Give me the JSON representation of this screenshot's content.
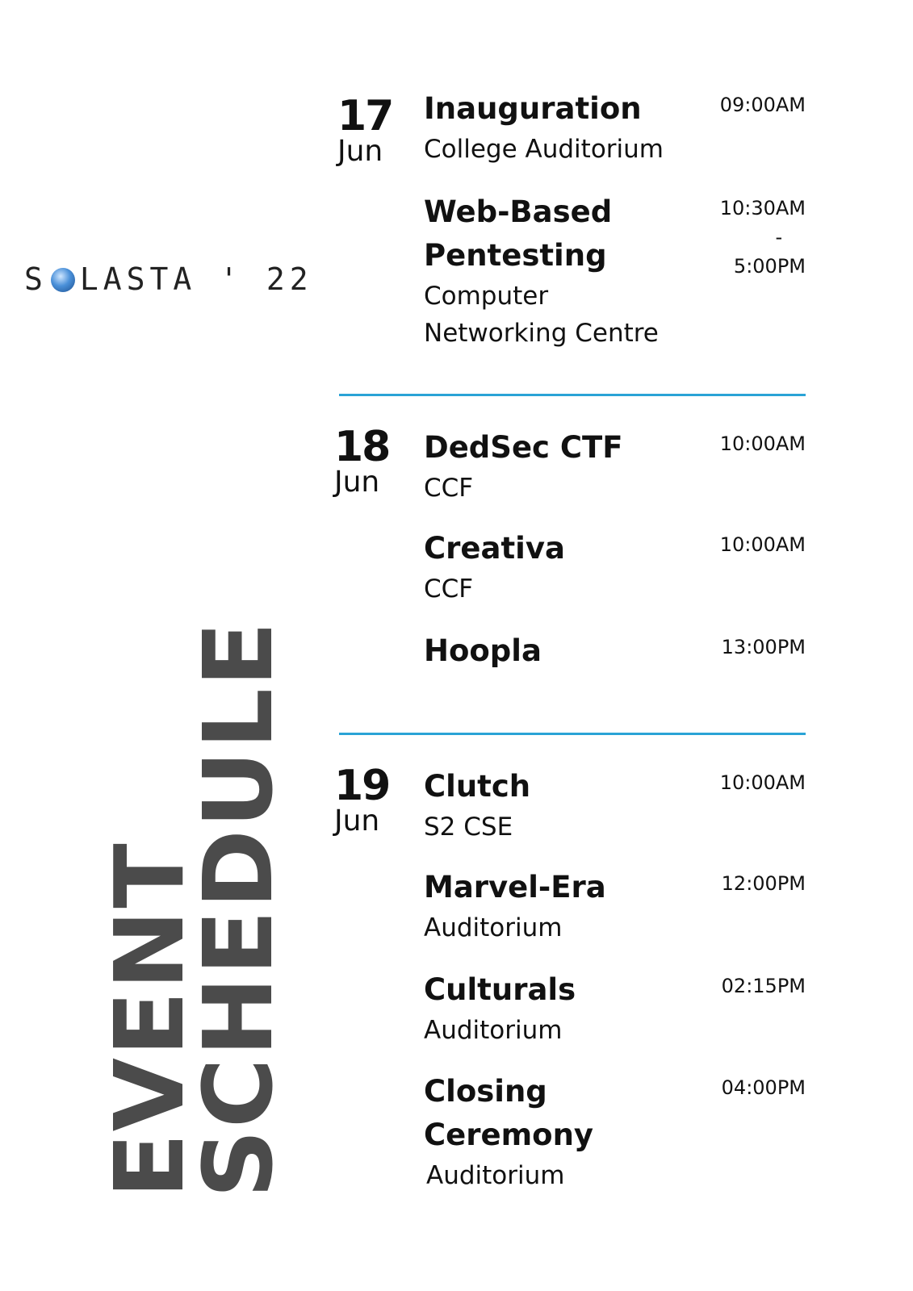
{
  "logo": {
    "left": "S",
    "right": "LASTA ' 22"
  },
  "title": {
    "line1": "EVENT",
    "line2": "SCHEDULE"
  },
  "days": [
    {
      "day": "17",
      "month": "Jun",
      "events": [
        {
          "name": "Inauguration",
          "venue": "College Auditorium",
          "time": "09:00AM"
        },
        {
          "name": "Web-Based Pentesting",
          "venue": "Computer Networking Centre",
          "time_start": "10:30AM",
          "time_sep": "-",
          "time_end": "5:00PM"
        }
      ]
    },
    {
      "day": "18",
      "month": "Jun",
      "events": [
        {
          "name": "DedSec CTF",
          "venue": "CCF",
          "time": "10:00AM"
        },
        {
          "name": "Creativa",
          "venue": "CCF",
          "time": "10:00AM"
        },
        {
          "name": "Hoopla",
          "time": "13:00PM"
        }
      ]
    },
    {
      "day": "19",
      "month": "Jun",
      "events": [
        {
          "name": "Clutch",
          "venue": "S2 CSE",
          "time": "10:00AM"
        },
        {
          "name": "Marvel-Era",
          "venue": "Auditorium",
          "time": "12:00PM"
        },
        {
          "name": "Culturals",
          "venue": "Auditorium",
          "time": "02:15PM"
        },
        {
          "name": "Closing Ceremony",
          "venue": "Auditorium",
          "time": "04:00PM"
        }
      ]
    }
  ],
  "colors": {
    "divider": "#2aa3d6",
    "title": "#4b4b4b"
  }
}
